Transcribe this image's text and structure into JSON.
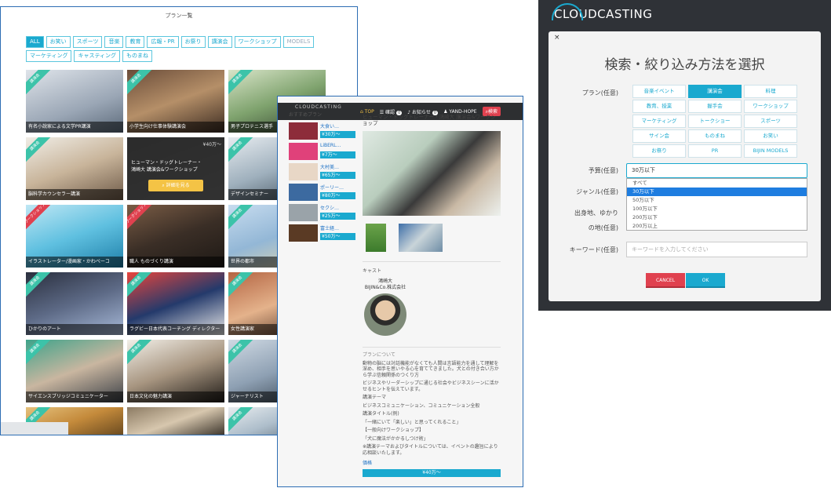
{
  "panel1": {
    "title": "プラン一覧",
    "filters": [
      "ALL",
      "お笑い",
      "スポーツ",
      "音楽",
      "教育",
      "広報・PR",
      "お祭り",
      "講演会",
      "ワークショップ",
      "MODELS",
      "マーケティング",
      "キャスティング",
      "ものまね"
    ],
    "tiles": [
      {
        "ribbon": "講演会",
        "caption": "有名小說家による文学PR講演"
      },
      {
        "ribbon": "講演会",
        "caption": "小学生向け仕事体験講演会"
      },
      {
        "ribbon": "講演会",
        "caption": "男子プロテニス選手"
      },
      {
        "ribbon": "講演会",
        "caption": "脳科学カウンセラー講演"
      },
      {
        "ribbon": "",
        "caption": ""
      },
      {
        "ribbon": "講演会",
        "caption": "デザインセミナー"
      },
      {
        "ribbon": "ワークショップ",
        "caption": "イラストレーター/漫画家・かわべーコ"
      },
      {
        "ribbon": "ワークショップ",
        "caption": "職人 ものづくり講演"
      },
      {
        "ribbon": "講演会",
        "caption": "世界の都市"
      },
      {
        "ribbon": "講演会",
        "caption": "ひかりのアート"
      },
      {
        "ribbon": "講演会",
        "caption": "ラグビー日本代表コーチング ディレクター"
      },
      {
        "ribbon": "講演会",
        "caption": "女性講演家"
      },
      {
        "ribbon": "講演会",
        "caption": "サイエンスブリッジコミュニケーター"
      },
      {
        "ribbon": "講演会",
        "caption": "日本文化の魅力講演"
      },
      {
        "ribbon": "講演会",
        "caption": "ジャーナリスト"
      },
      {
        "ribbon": "講演会",
        "caption": ""
      },
      {
        "ribbon": "",
        "caption": ""
      },
      {
        "ribbon": "講演会",
        "caption": ""
      }
    ],
    "overlay": {
      "title": "ヒューマン・ドッグトレーナー・鴻崎大 講演会&ワークショップ",
      "price": "¥40万〜",
      "button": "詳細を見る"
    }
  },
  "panel2": {
    "logo": "CLOUDCASTING",
    "nav": {
      "top": "TOP",
      "req": "確認",
      "req_count": "0",
      "news": "お知らせ",
      "news_count": "0",
      "user": "YAND-HOPE",
      "search": "検索"
    },
    "side_heading": "おすすめプラン",
    "side_items": [
      {
        "name": "大食い…",
        "price": "¥30万〜"
      },
      {
        "name": "LiBERL…",
        "price": "¥7万〜"
      },
      {
        "name": "大村美…",
        "price": "¥65万〜"
      },
      {
        "name": "ポーリー…",
        "price": "¥80万〜"
      },
      {
        "name": "セクシ…",
        "price": "¥25万〜"
      },
      {
        "name": "富士経…",
        "price": "¥50万〜"
      }
    ],
    "plan_title": "ヒューマン・ドッグトレーナー・鴻崎大 講演会&ワークショップ",
    "cast_heading": "キャスト",
    "cast_name": "鴻崎大",
    "cast_company": "BIJIN&Co.株式会社",
    "about_heading": "プランについて",
    "about_lines": [
      "動物の脳には対話機能がなくても人間は言語能力を通して理解を深め、相手を思いやる心を育ててきました。犬との付き合い方から学ぶ信頼関係のつくり方",
      "ビジネスやリーダーシップに通じる社会やビジネスシーンに活かせるヒントを伝えています。",
      "講演テーマ",
      "ビジネスコミュニケーション、コミュニケーション全般",
      "講演タイトル(例)",
      "「一緒にいて「楽しい」と思ってくれること」",
      "【一般向けワークショップ】",
      "「犬に魔法がかかるしつけ術」",
      "※講演テーマおよびタイトルについては、イベントの趣旨により応相談いたします。"
    ],
    "price_heading": "価格",
    "price": "¥40万〜"
  },
  "panel3": {
    "brand": "CLOUDCASTING",
    "modal_title": "検索・絞り込み方法を選択",
    "plan_label": "プラン(任意)",
    "plan_options": [
      "音楽イベント",
      "講演会",
      "料理",
      "教育、授業",
      "握手会",
      "ワークショップ",
      "マーケティング",
      "トークショー",
      "スポーツ",
      "サイン会",
      "ものまね",
      "お笑い",
      "お祭り",
      "PR",
      "BIJIN MODELS"
    ],
    "plan_selected": "講演会",
    "budget_label": "予算(任意)",
    "budget_value": "30万以下",
    "budget_options": [
      "すべて",
      "30万以下",
      "50万以下",
      "100万以下",
      "200万以下",
      "200万以上"
    ],
    "budget_highlight": "30万以下",
    "genre_label": "ジャンル(任意)",
    "origin_label_1": "出身地、ゆかり",
    "origin_label_2": "の地(任意)",
    "keyword_label": "キーワード(任意)",
    "keyword_placeholder": "キーワードを入力してください",
    "cancel": "CANCEL",
    "ok": "OK",
    "close": "×"
  },
  "colors": {
    "accent": "#1aa9cf",
    "danger": "#e0414f",
    "ribbon": "#3cc3a9",
    "button": "#f4c345",
    "frame": "#2d6db3"
  }
}
